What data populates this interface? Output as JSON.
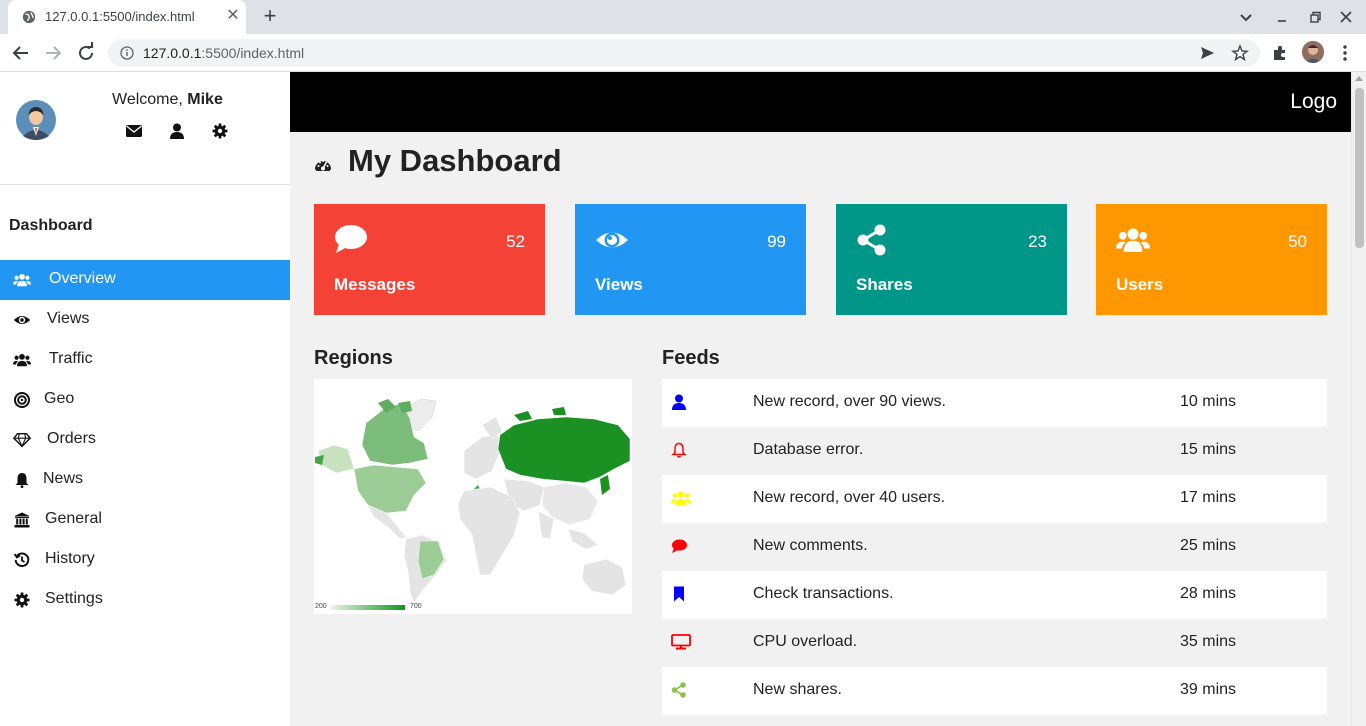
{
  "browser": {
    "tab_title": "127.0.0.1:5500/index.html",
    "url_host": "127.0.0.1",
    "url_rest": ":5500/index.html"
  },
  "sidebar": {
    "welcome_prefix": "Welcome, ",
    "user_name": "Mike",
    "heading": "Dashboard",
    "items": [
      {
        "label": "Overview",
        "icon": "users-icon",
        "active": true
      },
      {
        "label": "Views",
        "icon": "eye-icon"
      },
      {
        "label": "Traffic",
        "icon": "users-icon"
      },
      {
        "label": "Geo",
        "icon": "bullseye-icon"
      },
      {
        "label": "Orders",
        "icon": "diamond-icon"
      },
      {
        "label": "News",
        "icon": "bell-icon"
      },
      {
        "label": "General",
        "icon": "bank-icon"
      },
      {
        "label": "History",
        "icon": "history-icon"
      },
      {
        "label": "Settings",
        "icon": "gear-icon"
      }
    ]
  },
  "header": {
    "logo": "Logo"
  },
  "main": {
    "title": "My Dashboard",
    "cards": [
      {
        "label": "Messages",
        "value": "52",
        "color": "#f44336",
        "icon": "comment-icon"
      },
      {
        "label": "Views",
        "value": "99",
        "color": "#2196f3",
        "icon": "eye-icon"
      },
      {
        "label": "Shares",
        "value": "23",
        "color": "#009688",
        "icon": "share-icon"
      },
      {
        "label": "Users",
        "value": "50",
        "color": "#ff9800",
        "icon": "users-icon"
      }
    ],
    "regions": {
      "title": "Regions",
      "legend_min": "200",
      "legend_max": "700"
    },
    "feeds": {
      "title": "Feeds",
      "rows": [
        {
          "text": "New record, over 90 views.",
          "time": "10 mins",
          "icon": "user-icon",
          "color": "#0000ff"
        },
        {
          "text": "Database error.",
          "time": "15 mins",
          "icon": "bell-icon",
          "color": "#ff0000"
        },
        {
          "text": "New record, over 40 users.",
          "time": "17 mins",
          "icon": "users-icon",
          "color": "#ffff00"
        },
        {
          "text": "New comments.",
          "time": "25 mins",
          "icon": "comment-icon",
          "color": "#ff0000"
        },
        {
          "text": "Check transactions.",
          "time": "28 mins",
          "icon": "bookmark-icon",
          "color": "#0000ff"
        },
        {
          "text": "CPU overload.",
          "time": "35 mins",
          "icon": "laptop-icon",
          "color": "#ff0000"
        },
        {
          "text": "New shares.",
          "time": "39 mins",
          "icon": "share-icon",
          "color": "#8bc34a"
        }
      ]
    }
  }
}
